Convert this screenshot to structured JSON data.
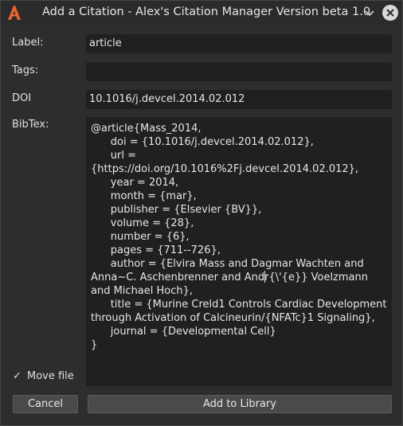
{
  "window": {
    "title": "Add a Citation - Alex's Citation Manager Version beta 1.0",
    "icons": {
      "logo": "app-logo-icon",
      "menu": "chevron-down-icon",
      "close": "close-icon"
    },
    "accent": "#e8642c"
  },
  "form": {
    "label_label": "Label:",
    "label_value": "article",
    "tags_label": "Tags:",
    "tags_value": "",
    "doi_label": "DOI",
    "doi_value": "10.1016/j.devcel.2014.02.012",
    "bibtex_label": "BibTex:",
    "bibtex_value": "@article{Mass_2014,\n\tdoi = {10.1016/j.devcel.2014.02.012},\n\turl = {https://doi.org/10.1016%2Fj.devcel.2014.02.012},\n\tyear = 2014,\n\tmonth = {mar},\n\tpublisher = {Elsevier {BV}},\n\tvolume = {28},\n\tnumber = {6},\n\tpages = {711--726},\n\tauthor = {Elvira Mass and Dagmar Wachten and Anna~C. Aschenbrenner and Andr{\\'{e}} Voelzmann and Michael Hoch},\n\ttitle = {Murine Creld1 Controls Cardiac Development through Activation of Calcineurin/{NFATc}1 Signaling},\n\tjournal = {Developmental Cell}\n}"
  },
  "options": {
    "move_file_check": "✓",
    "move_file_label": "Move file"
  },
  "buttons": {
    "cancel": "Cancel",
    "add": "Add to Library"
  }
}
